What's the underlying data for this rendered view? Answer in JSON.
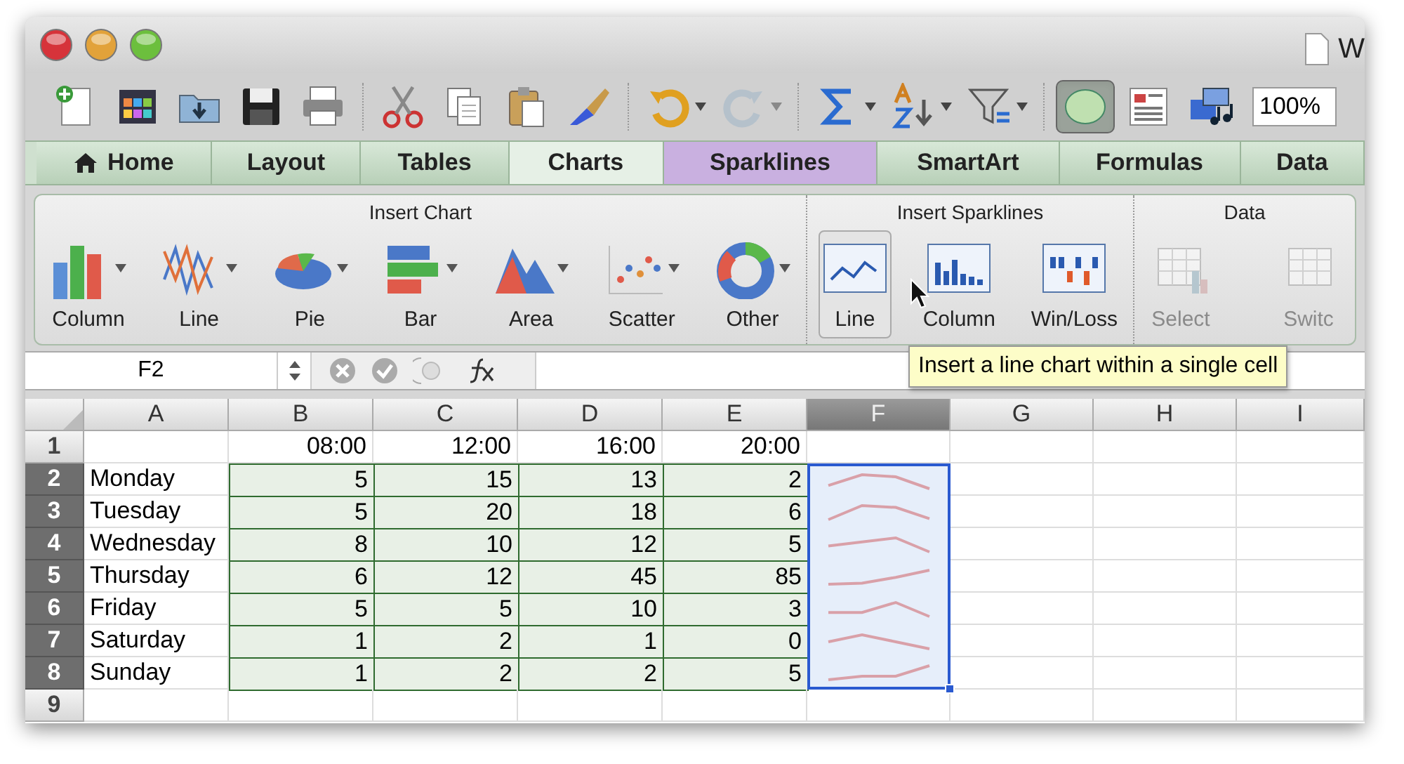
{
  "window": {
    "title": "W"
  },
  "toolbar": [
    {
      "menu": false,
      "disabled": false,
      "pressed": false
    },
    {
      "menu": false,
      "disabled": false,
      "pressed": false
    },
    {
      "menu": false,
      "disabled": false,
      "pressed": false
    },
    {
      "menu": false,
      "disabled": false,
      "pressed": false
    },
    {
      "menu": false,
      "disabled": false,
      "pressed": false
    },
    {
      "menu": false,
      "disabled": false,
      "pressed": false
    },
    {
      "menu": false,
      "disabled": false,
      "pressed": false
    },
    {
      "menu": false,
      "disabled": false,
      "pressed": false
    },
    {
      "menu": false,
      "disabled": false,
      "pressed": false
    },
    {
      "menu": true,
      "disabled": false,
      "pressed": false
    },
    {
      "menu": true,
      "disabled": true,
      "pressed": false
    },
    {
      "menu": true,
      "disabled": false,
      "pressed": false
    },
    {
      "menu": true,
      "disabled": false,
      "pressed": false
    },
    {
      "menu": true,
      "disabled": false,
      "pressed": false
    },
    {
      "menu": false,
      "disabled": false,
      "pressed": true
    },
    {
      "menu": false,
      "disabled": false,
      "pressed": false
    },
    {
      "menu": false,
      "disabled": false,
      "pressed": false
    }
  ],
  "zoom": {
    "value": "100%"
  },
  "tabs": [
    {
      "label": "Home",
      "kind": "home",
      "selected": false
    },
    {
      "label": "Layout",
      "kind": "tab",
      "selected": false
    },
    {
      "label": "Tables",
      "kind": "tab",
      "selected": false
    },
    {
      "label": "Charts",
      "kind": "parent",
      "selected": false
    },
    {
      "label": "Sparklines",
      "kind": "contextual",
      "selected": true
    },
    {
      "label": "SmartArt",
      "kind": "tab",
      "selected": false
    },
    {
      "label": "Formulas",
      "kind": "tab",
      "selected": false
    },
    {
      "label": "Data",
      "kind": "tab",
      "selected": false
    }
  ],
  "ribbon": {
    "groups": [
      {
        "title": "Insert Chart",
        "buttons": [
          {
            "label": "Column",
            "menu": true,
            "disabled": false,
            "hovered": false
          },
          {
            "label": "Line",
            "menu": true,
            "disabled": false,
            "hovered": false
          },
          {
            "label": "Pie",
            "menu": true,
            "disabled": false,
            "hovered": false
          },
          {
            "label": "Bar",
            "menu": true,
            "disabled": false,
            "hovered": false
          },
          {
            "label": "Area",
            "menu": true,
            "disabled": false,
            "hovered": false
          },
          {
            "label": "Scatter",
            "menu": true,
            "disabled": false,
            "hovered": false
          },
          {
            "label": "Other",
            "menu": true,
            "disabled": false,
            "hovered": false
          }
        ]
      },
      {
        "title": "Insert Sparklines",
        "buttons": [
          {
            "label": "Line",
            "menu": false,
            "disabled": false,
            "hovered": true
          },
          {
            "label": "Column",
            "menu": false,
            "disabled": false,
            "hovered": false
          },
          {
            "label": "Win/Loss",
            "menu": false,
            "disabled": false,
            "hovered": false
          }
        ]
      },
      {
        "title": "Data",
        "buttons": [
          {
            "label": "Select",
            "menu": false,
            "disabled": true,
            "hovered": false
          },
          {
            "label": "Switc",
            "menu": false,
            "disabled": true,
            "hovered": false
          }
        ]
      }
    ]
  },
  "tooltip": {
    "text": "Insert a line chart within a single cell"
  },
  "formula_bar": {
    "name_box": "F2"
  },
  "sheet": {
    "columns": [
      {
        "label": "A",
        "selected": false
      },
      {
        "label": "B",
        "selected": false
      },
      {
        "label": "C",
        "selected": false
      },
      {
        "label": "D",
        "selected": false
      },
      {
        "label": "E",
        "selected": false
      },
      {
        "label": "F",
        "selected": true
      },
      {
        "label": "G",
        "selected": false
      },
      {
        "label": "H",
        "selected": false
      },
      {
        "label": "I",
        "selected": false
      }
    ],
    "rows": [
      {
        "label": "1",
        "selected": false,
        "sparkline": false,
        "cells": [
          "",
          "08:00",
          "12:00",
          "16:00",
          "20:00"
        ]
      },
      {
        "label": "2",
        "selected": true,
        "sparkline": true,
        "cells": [
          "Monday",
          "5",
          "15",
          "13",
          "2"
        ]
      },
      {
        "label": "3",
        "selected": true,
        "sparkline": true,
        "cells": [
          "Tuesday",
          "5",
          "20",
          "18",
          "6"
        ]
      },
      {
        "label": "4",
        "selected": true,
        "sparkline": true,
        "cells": [
          "Wednesday",
          "8",
          "10",
          "12",
          "5"
        ]
      },
      {
        "label": "5",
        "selected": true,
        "sparkline": true,
        "cells": [
          "Thursday",
          "6",
          "12",
          "45",
          "85"
        ]
      },
      {
        "label": "6",
        "selected": true,
        "sparkline": true,
        "cells": [
          "Friday",
          "5",
          "5",
          "10",
          "3"
        ]
      },
      {
        "label": "7",
        "selected": true,
        "sparkline": true,
        "cells": [
          "Saturday",
          "1",
          "2",
          "1",
          "0"
        ]
      },
      {
        "label": "8",
        "selected": true,
        "sparkline": true,
        "cells": [
          "Sunday",
          "1",
          "2",
          "2",
          "5"
        ]
      },
      {
        "label": "9",
        "selected": false,
        "sparkline": false,
        "cells": []
      }
    ]
  }
}
